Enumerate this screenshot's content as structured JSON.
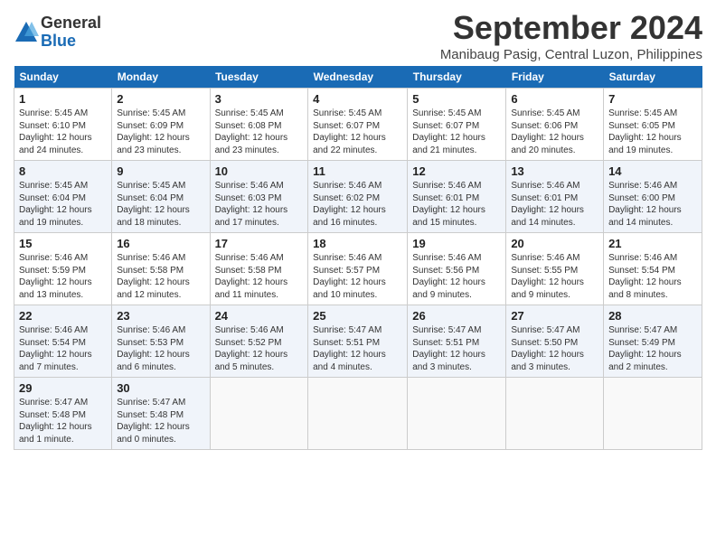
{
  "header": {
    "logo_line1": "General",
    "logo_line2": "Blue",
    "month": "September 2024",
    "location": "Manibaug Pasig, Central Luzon, Philippines"
  },
  "weekdays": [
    "Sunday",
    "Monday",
    "Tuesday",
    "Wednesday",
    "Thursday",
    "Friday",
    "Saturday"
  ],
  "weeks": [
    [
      {
        "day": "1",
        "info": "Sunrise: 5:45 AM\nSunset: 6:10 PM\nDaylight: 12 hours\nand 24 minutes."
      },
      {
        "day": "2",
        "info": "Sunrise: 5:45 AM\nSunset: 6:09 PM\nDaylight: 12 hours\nand 23 minutes."
      },
      {
        "day": "3",
        "info": "Sunrise: 5:45 AM\nSunset: 6:08 PM\nDaylight: 12 hours\nand 23 minutes."
      },
      {
        "day": "4",
        "info": "Sunrise: 5:45 AM\nSunset: 6:07 PM\nDaylight: 12 hours\nand 22 minutes."
      },
      {
        "day": "5",
        "info": "Sunrise: 5:45 AM\nSunset: 6:07 PM\nDaylight: 12 hours\nand 21 minutes."
      },
      {
        "day": "6",
        "info": "Sunrise: 5:45 AM\nSunset: 6:06 PM\nDaylight: 12 hours\nand 20 minutes."
      },
      {
        "day": "7",
        "info": "Sunrise: 5:45 AM\nSunset: 6:05 PM\nDaylight: 12 hours\nand 19 minutes."
      }
    ],
    [
      {
        "day": "8",
        "info": "Sunrise: 5:45 AM\nSunset: 6:04 PM\nDaylight: 12 hours\nand 19 minutes."
      },
      {
        "day": "9",
        "info": "Sunrise: 5:45 AM\nSunset: 6:04 PM\nDaylight: 12 hours\nand 18 minutes."
      },
      {
        "day": "10",
        "info": "Sunrise: 5:46 AM\nSunset: 6:03 PM\nDaylight: 12 hours\nand 17 minutes."
      },
      {
        "day": "11",
        "info": "Sunrise: 5:46 AM\nSunset: 6:02 PM\nDaylight: 12 hours\nand 16 minutes."
      },
      {
        "day": "12",
        "info": "Sunrise: 5:46 AM\nSunset: 6:01 PM\nDaylight: 12 hours\nand 15 minutes."
      },
      {
        "day": "13",
        "info": "Sunrise: 5:46 AM\nSunset: 6:01 PM\nDaylight: 12 hours\nand 14 minutes."
      },
      {
        "day": "14",
        "info": "Sunrise: 5:46 AM\nSunset: 6:00 PM\nDaylight: 12 hours\nand 14 minutes."
      }
    ],
    [
      {
        "day": "15",
        "info": "Sunrise: 5:46 AM\nSunset: 5:59 PM\nDaylight: 12 hours\nand 13 minutes."
      },
      {
        "day": "16",
        "info": "Sunrise: 5:46 AM\nSunset: 5:58 PM\nDaylight: 12 hours\nand 12 minutes."
      },
      {
        "day": "17",
        "info": "Sunrise: 5:46 AM\nSunset: 5:58 PM\nDaylight: 12 hours\nand 11 minutes."
      },
      {
        "day": "18",
        "info": "Sunrise: 5:46 AM\nSunset: 5:57 PM\nDaylight: 12 hours\nand 10 minutes."
      },
      {
        "day": "19",
        "info": "Sunrise: 5:46 AM\nSunset: 5:56 PM\nDaylight: 12 hours\nand 9 minutes."
      },
      {
        "day": "20",
        "info": "Sunrise: 5:46 AM\nSunset: 5:55 PM\nDaylight: 12 hours\nand 9 minutes."
      },
      {
        "day": "21",
        "info": "Sunrise: 5:46 AM\nSunset: 5:54 PM\nDaylight: 12 hours\nand 8 minutes."
      }
    ],
    [
      {
        "day": "22",
        "info": "Sunrise: 5:46 AM\nSunset: 5:54 PM\nDaylight: 12 hours\nand 7 minutes."
      },
      {
        "day": "23",
        "info": "Sunrise: 5:46 AM\nSunset: 5:53 PM\nDaylight: 12 hours\nand 6 minutes."
      },
      {
        "day": "24",
        "info": "Sunrise: 5:46 AM\nSunset: 5:52 PM\nDaylight: 12 hours\nand 5 minutes."
      },
      {
        "day": "25",
        "info": "Sunrise: 5:47 AM\nSunset: 5:51 PM\nDaylight: 12 hours\nand 4 minutes."
      },
      {
        "day": "26",
        "info": "Sunrise: 5:47 AM\nSunset: 5:51 PM\nDaylight: 12 hours\nand 3 minutes."
      },
      {
        "day": "27",
        "info": "Sunrise: 5:47 AM\nSunset: 5:50 PM\nDaylight: 12 hours\nand 3 minutes."
      },
      {
        "day": "28",
        "info": "Sunrise: 5:47 AM\nSunset: 5:49 PM\nDaylight: 12 hours\nand 2 minutes."
      }
    ],
    [
      {
        "day": "29",
        "info": "Sunrise: 5:47 AM\nSunset: 5:48 PM\nDaylight: 12 hours\nand 1 minute."
      },
      {
        "day": "30",
        "info": "Sunrise: 5:47 AM\nSunset: 5:48 PM\nDaylight: 12 hours\nand 0 minutes."
      },
      {
        "day": "",
        "info": ""
      },
      {
        "day": "",
        "info": ""
      },
      {
        "day": "",
        "info": ""
      },
      {
        "day": "",
        "info": ""
      },
      {
        "day": "",
        "info": ""
      }
    ]
  ]
}
